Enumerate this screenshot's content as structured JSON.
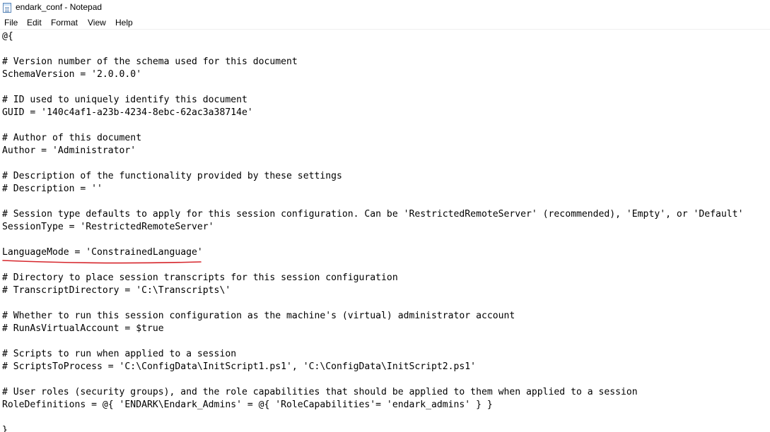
{
  "window": {
    "title": "endark_conf - Notepad"
  },
  "menu": {
    "file": "File",
    "edit": "Edit",
    "format": "Format",
    "view": "View",
    "help": "Help"
  },
  "editor": {
    "lines": [
      "@{",
      "",
      "# Version number of the schema used for this document",
      "SchemaVersion = '2.0.0.0'",
      "",
      "# ID used to uniquely identify this document",
      "GUID = '140c4af1-a23b-4234-8ebc-62ac3a38714e'",
      "",
      "# Author of this document",
      "Author = 'Administrator'",
      "",
      "# Description of the functionality provided by these settings",
      "# Description = ''",
      "",
      "# Session type defaults to apply for this session configuration. Can be 'RestrictedRemoteServer' (recommended), 'Empty', or 'Default'",
      "SessionType = 'RestrictedRemoteServer'",
      "",
      "LanguageMode = 'ConstrainedLanguage'",
      "",
      "# Directory to place session transcripts for this session configuration",
      "# TranscriptDirectory = 'C:\\Transcripts\\'",
      "",
      "# Whether to run this session configuration as the machine's (virtual) administrator account",
      "# RunAsVirtualAccount = $true",
      "",
      "# Scripts to run when applied to a session",
      "# ScriptsToProcess = 'C:\\ConfigData\\InitScript1.ps1', 'C:\\ConfigData\\InitScript2.ps1'",
      "",
      "# User roles (security groups), and the role capabilities that should be applied to them when applied to a session",
      "RoleDefinitions = @{ 'ENDARK\\Endark_Admins' = @{ 'RoleCapabilities'= 'endark_admins' } }",
      "",
      "}"
    ]
  },
  "colors": {
    "annotation_underline": "#d6262c"
  }
}
